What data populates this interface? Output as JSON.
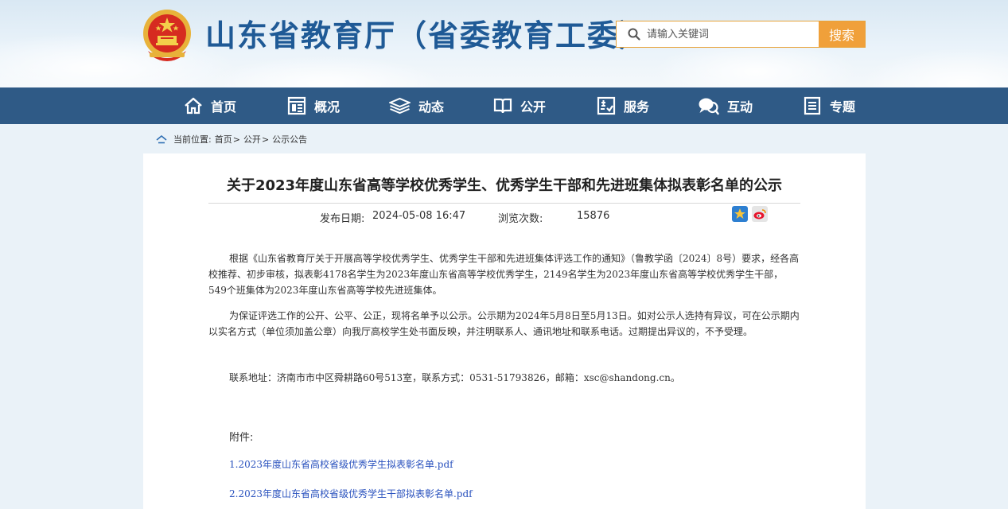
{
  "header": {
    "site_title": "山东省教育厅（省委教育工委）",
    "search": {
      "placeholder": "请输入关键词",
      "button_label": "搜索"
    }
  },
  "nav": {
    "items": [
      {
        "label": "首页",
        "icon": "home-icon"
      },
      {
        "label": "概况",
        "icon": "overview-icon"
      },
      {
        "label": "动态",
        "icon": "news-icon"
      },
      {
        "label": "公开",
        "icon": "book-icon"
      },
      {
        "label": "服务",
        "icon": "service-icon"
      },
      {
        "label": "互动",
        "icon": "chat-icon"
      },
      {
        "label": "专题",
        "icon": "topic-icon"
      }
    ]
  },
  "breadcrumb": {
    "prefix": "当前位置:",
    "items": [
      "首页",
      "公开",
      "公示公告"
    ],
    "separator": ">"
  },
  "article": {
    "title": "关于2023年度山东省高等学校优秀学生、优秀学生干部和先进班集体拟表彰名单的公示",
    "publish_label": "发布日期:",
    "publish_date": "2024-05-08 16:47",
    "views_label": "浏览次数:",
    "views": "15876",
    "paragraphs": [
      "根据《山东省教育厅关于开展高等学校优秀学生、优秀学生干部和先进班集体评选工作的通知》（鲁教学函〔2024〕8号）要求，经各高校推荐、初步审核，拟表彰4178名学生为2023年度山东省高等学校优秀学生，2149名学生为2023年度山东省高等学校优秀学生干部，549个班集体为2023年度山东省高等学校先进班集体。",
      "为保证评选工作的公开、公平、公正，现将名单予以公示。公示期为2024年5月8日至5月13日。如对公示人选持有异议，可在公示期内以实名方式（单位须加盖公章）向我厅高校学生处书面反映，并注明联系人、通讯地址和联系电话。过期提出异议的，不予受理。",
      "联系地址：济南市市中区舜耕路60号513室，联系方式：0531-51793826，邮箱：xsc@shandong.cn。"
    ],
    "attachments_label": "附件:",
    "attachments": [
      "1.2023年度山东省高校省级优秀学生拟表彰名单.pdf",
      "2.2023年度山东省高校省级优秀学生干部拟表彰名单.pdf"
    ]
  },
  "colors": {
    "nav_bg": "#2f5a86",
    "title_blue": "#1f5a96",
    "search_accent": "#f0a03a",
    "link_blue": "#2a52be"
  }
}
